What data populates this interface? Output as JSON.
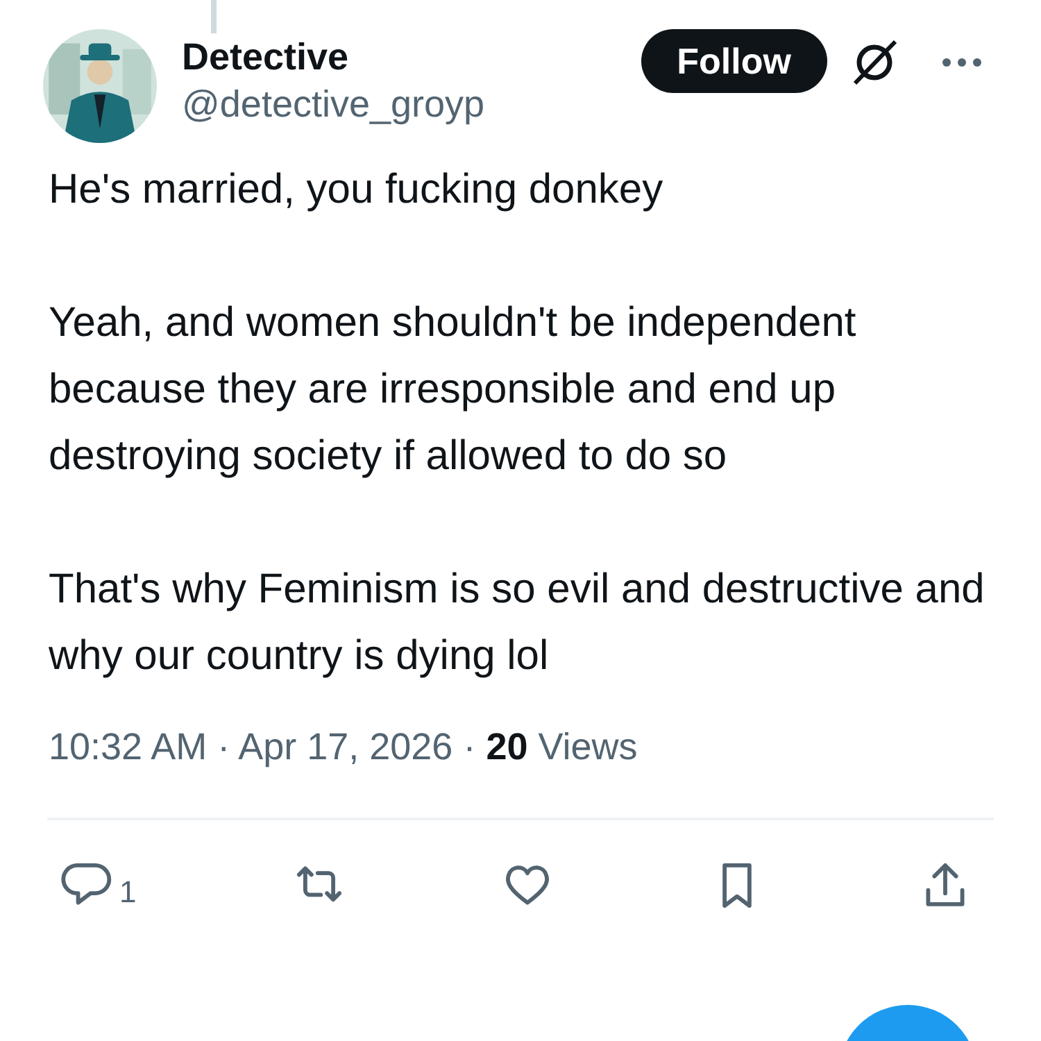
{
  "author": {
    "name": "Detective",
    "handle": "@detective_groyp"
  },
  "follow_button": "Follow",
  "paragraphs": [
    "He's married, you fucking donkey",
    "Yeah, and women shouldn't be independent because they are irresponsible and end up destroying society if allowed to do so",
    "That's why Feminism is so evil and destructive and why our country is dying lol"
  ],
  "meta": "10:32 AM · Apr 17, 2026 · **20** Views",
  "actions": [
    {
      "kind": "reply",
      "count": "1"
    },
    {
      "kind": "repost"
    },
    {
      "kind": "like"
    },
    {
      "kind": "bookmark"
    },
    {
      "kind": "share"
    }
  ]
}
